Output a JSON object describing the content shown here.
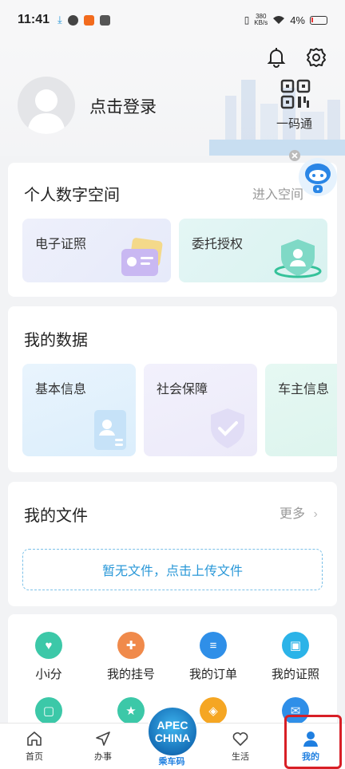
{
  "status_bar": {
    "time": "11:41",
    "net_speed_top": "380",
    "net_speed_bottom": "KB/s",
    "battery": "4%",
    "icons": [
      "download-icon",
      "app-icon",
      "app-icon",
      "app-icon",
      "vibrate-icon",
      "wifi-icon",
      "battery-icon"
    ]
  },
  "header": {
    "login_text": "点击登录",
    "qr_label": "一码通",
    "icons": [
      "bell-icon",
      "gear-icon",
      "qr-code-icon",
      "avatar-placeholder"
    ]
  },
  "digital_space": {
    "title": "个人数字空间",
    "link": "进入空间",
    "tiles": [
      {
        "label": "电子证照",
        "icon": "id-card-icon"
      },
      {
        "label": "委托授权",
        "icon": "shield-user-icon"
      }
    ]
  },
  "my_data": {
    "title": "我的数据",
    "tiles": [
      {
        "label": "基本信息",
        "icon": "profile-card-icon"
      },
      {
        "label": "社会保障",
        "icon": "shield-check-icon"
      },
      {
        "label": "车主信息",
        "icon": "car-icon"
      }
    ]
  },
  "my_files": {
    "title": "我的文件",
    "more": "更多",
    "empty_text": "暂无文件，点击上传文件"
  },
  "services": [
    {
      "label": "小i分",
      "icon": "score-icon",
      "color": "#3cc8a8"
    },
    {
      "label": "我的挂号",
      "icon": "medical-cross-icon",
      "color": "#f08a4b"
    },
    {
      "label": "我的订单",
      "icon": "order-list-icon",
      "color": "#2f8fe8"
    },
    {
      "label": "我的证照",
      "icon": "certificate-icon",
      "color": "#2bb3e8"
    },
    {
      "label": "",
      "icon": "person-card-icon",
      "color": "#3cc8a8"
    },
    {
      "label": "",
      "icon": "star-icon",
      "color": "#3cc8a8"
    },
    {
      "label": "",
      "icon": "compass-icon",
      "color": "#f5a623"
    },
    {
      "label": "",
      "icon": "letter-icon",
      "color": "#2f8fe8"
    }
  ],
  "tabbar": {
    "tabs": [
      {
        "label": "首页",
        "icon": "home-icon"
      },
      {
        "label": "办事",
        "icon": "send-icon"
      },
      {
        "label": "乘车码",
        "icon": "apec-logo"
      },
      {
        "label": "生活",
        "icon": "heart-icon"
      },
      {
        "label": "我的",
        "icon": "person-icon"
      }
    ],
    "apec_top": "APEC",
    "apec_bottom": "CHINA"
  },
  "colors": {
    "accent": "#1f7fe0",
    "highlight": "#d81f26",
    "upload_text": "#2a98d8"
  }
}
